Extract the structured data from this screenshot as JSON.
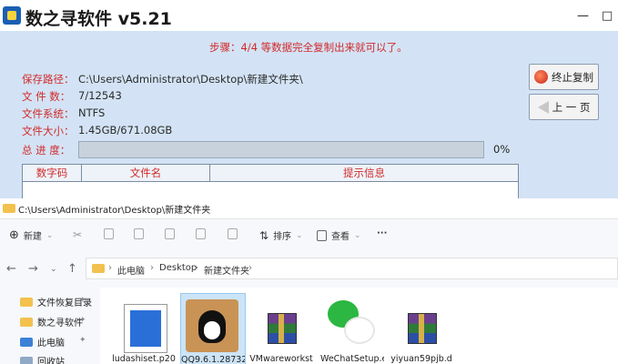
{
  "app": {
    "title": "数之寻软件 v5.21",
    "window_controls": [
      "—",
      "□"
    ],
    "step_text": "步骤：4/4 等数据完全复制出来就可以了。",
    "info": [
      {
        "label": "保存路径：",
        "value": "C:\\Users\\Administrator\\Desktop\\新建文件夹\\"
      },
      {
        "label": "文 件 数：",
        "value": "7/12543"
      },
      {
        "label": "文件系统：",
        "value": "NTFS"
      },
      {
        "label": "文件大小：",
        "value": "1.45GB/671.08GB"
      }
    ],
    "progress_label": "总 进 度：",
    "progress_fraction": 0.0,
    "progress_text": "0%",
    "buttons": {
      "stop": "终止复制",
      "back": "上 一 页"
    },
    "table_headers": [
      "数字码",
      "文件名",
      "提示信息"
    ]
  },
  "explorer": {
    "title_path": "C:\\Users\\Administrator\\Desktop\\新建文件夹",
    "toolbar": {
      "new": "新建",
      "sort": "排序",
      "view": "查看",
      "more": "···"
    },
    "breadcrumb": [
      "此电脑",
      "Desktop",
      "新建文件夹"
    ],
    "sidebar": [
      {
        "label": "文件恢复目录",
        "icon": "folder-icon"
      },
      {
        "label": "数之寻软件",
        "icon": "folder-icon"
      },
      {
        "label": "此电脑",
        "icon": "computer-icon"
      },
      {
        "label": "回收站",
        "icon": "recycle-bin-icon"
      }
    ],
    "files": [
      {
        "name": "ludashiset.p20",
        "icon": "document-icon"
      },
      {
        "name": "QQ9.6.1.28732.",
        "icon": "qq-installer-icon"
      },
      {
        "name": "VMwareworkst",
        "icon": "winrar-archive-icon"
      },
      {
        "name": "WeChatSetup.e",
        "icon": "wechat-icon"
      },
      {
        "name": "yiyuan59pjb.d",
        "icon": "winrar-archive-icon"
      }
    ],
    "colors": {
      "selected": "#cce4f7",
      "folder": "#f2c14e"
    }
  }
}
